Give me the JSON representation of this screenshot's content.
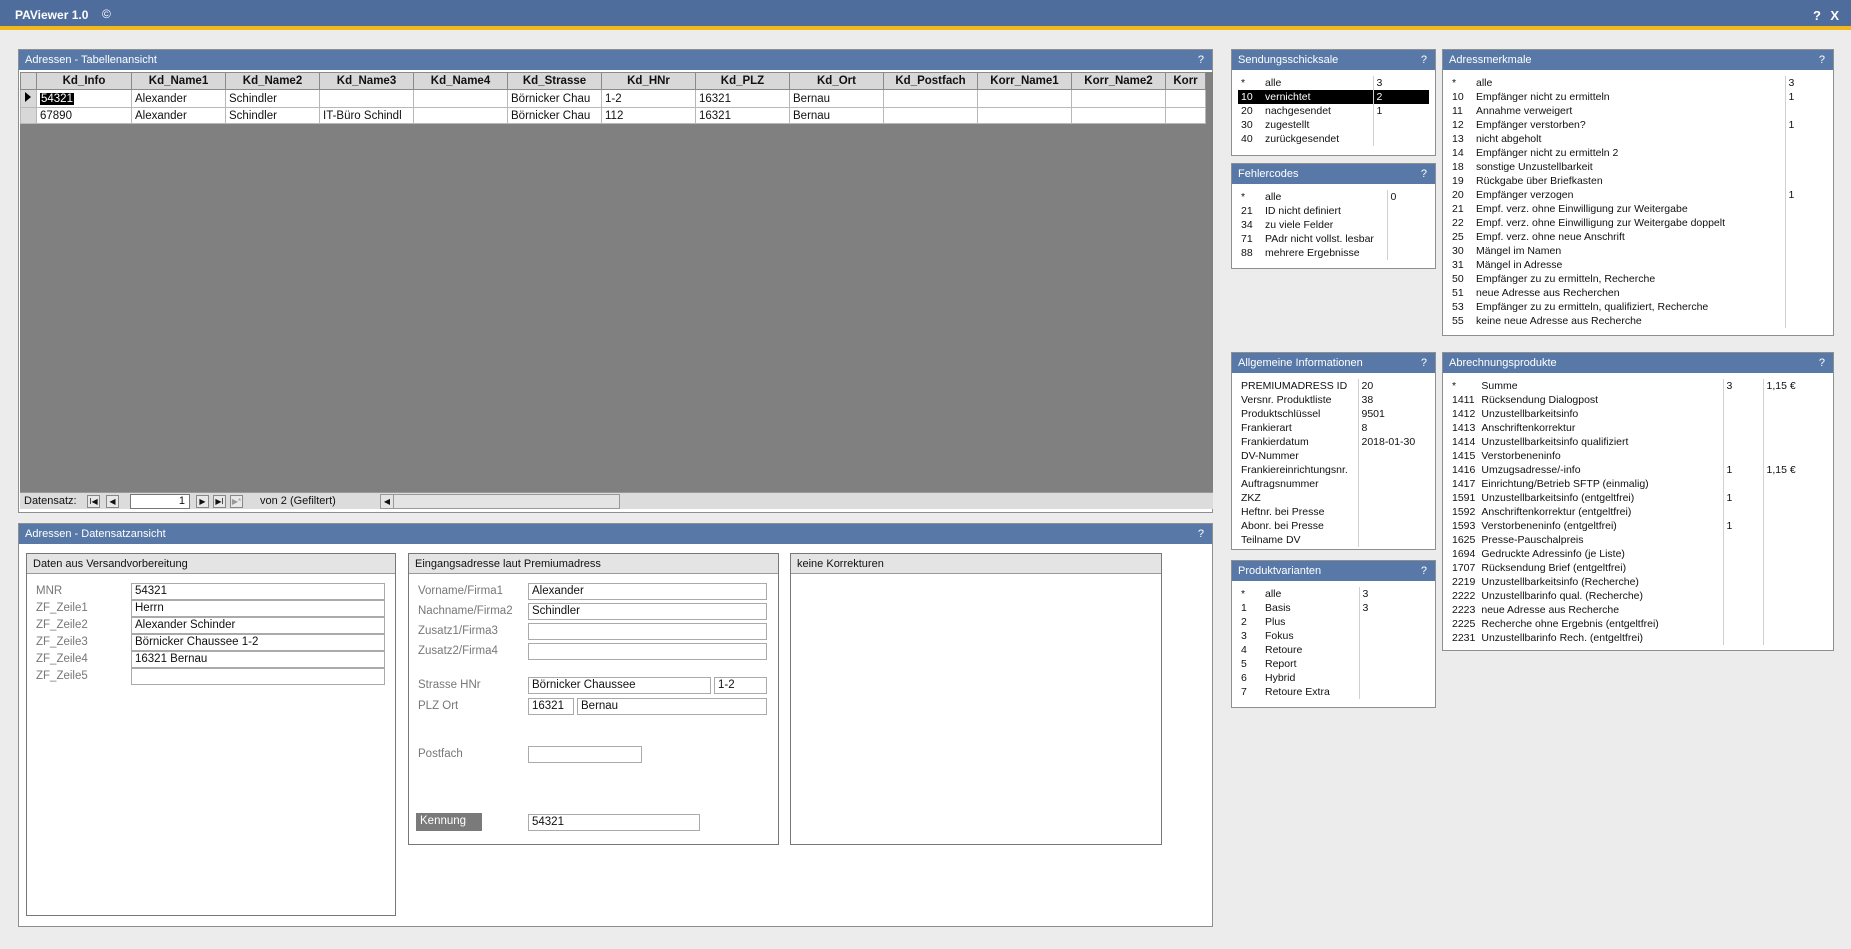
{
  "app": {
    "title": "PAViewer 1.0",
    "copyright": "©",
    "help": "?",
    "close": "X"
  },
  "table_view": {
    "title": "Adressen - Tabellenansicht",
    "help": "?",
    "columns": [
      "Kd_Info",
      "Kd_Name1",
      "Kd_Name2",
      "Kd_Name3",
      "Kd_Name4",
      "Kd_Strasse",
      "Kd_HNr",
      "Kd_PLZ",
      "Kd_Ort",
      "Kd_Postfach",
      "Korr_Name1",
      "Korr_Name2",
      "Korr"
    ],
    "rows": [
      [
        "54321",
        "Alexander",
        "Schindler",
        "",
        "",
        "Börnicker Chau",
        "1-2",
        "16321",
        "Bernau",
        "",
        "",
        "",
        ""
      ],
      [
        "67890",
        "Alexander",
        "Schindler",
        "IT-Büro Schindl",
        "",
        "Börnicker Chau",
        "112",
        "16321",
        "Bernau",
        "",
        "",
        "",
        ""
      ]
    ],
    "nav": {
      "label": "Datensatz:",
      "first": "I◀",
      "prev": "◀",
      "record": "1",
      "next": "▶",
      "last": "▶I",
      "new": "▶*",
      "of_text": "von  2 (Gefiltert)"
    }
  },
  "record_view": {
    "title": "Adressen - Datensatzansicht",
    "help": "?",
    "versand": {
      "title": "Daten aus Versandvorbereitung",
      "fields": [
        {
          "label": "MNR",
          "value": "54321"
        },
        {
          "label": "ZF_Zeile1",
          "value": "Herrn"
        },
        {
          "label": "ZF_Zeile2",
          "value": "Alexander Schinder"
        },
        {
          "label": "ZF_Zeile3",
          "value": "Börnicker Chaussee 1-2"
        },
        {
          "label": "ZF_Zeile4",
          "value": "16321 Bernau"
        },
        {
          "label": "ZF_Zeile5",
          "value": ""
        }
      ]
    },
    "eingang": {
      "title": "Eingangsadresse laut Premiumadress",
      "vorname_label": "Vorname/Firma1",
      "vorname": "Alexander",
      "nachname_label": "Nachname/Firma2",
      "nachname": "Schindler",
      "zusatz1_label": "Zusatz1/Firma3",
      "zusatz1": "",
      "zusatz2_label": "Zusatz2/Firma4",
      "zusatz2": "",
      "strasse_label": "Strasse HNr",
      "strasse": "Börnicker Chaussee",
      "hnr": "1-2",
      "plzort_label": "PLZ Ort",
      "plz": "16321",
      "ort": "Bernau",
      "postfach_label": "Postfach",
      "postfach": "",
      "kennung_label": "Kennung",
      "kennung": "54321"
    },
    "korrektur": {
      "title": "keine Korrekturen"
    }
  },
  "sendungsschicksale": {
    "title": "Sendungsschicksale",
    "help": "?",
    "rows": [
      [
        "*",
        "alle",
        "3"
      ],
      [
        "10",
        "vernichtet",
        "2"
      ],
      [
        "20",
        "nachgesendet",
        "1"
      ],
      [
        "30",
        "zugestellt",
        ""
      ],
      [
        "40",
        "zurückgesendet",
        ""
      ]
    ]
  },
  "fehlercodes": {
    "title": "Fehlercodes",
    "help": "?",
    "rows": [
      [
        "*",
        "alle",
        "0"
      ],
      [
        "21",
        "ID nicht definiert",
        ""
      ],
      [
        "34",
        "zu viele Felder",
        ""
      ],
      [
        "71",
        "PAdr nicht vollst. lesbar",
        ""
      ],
      [
        "88",
        "mehrere Ergebnisse",
        ""
      ]
    ]
  },
  "adressmerkmale": {
    "title": "Adressmerkmale",
    "help": "?",
    "rows": [
      [
        "*",
        "alle",
        "3"
      ],
      [
        "10",
        "Empfänger nicht zu ermitteln",
        "1"
      ],
      [
        "11",
        "Annahme verweigert",
        ""
      ],
      [
        "12",
        "Empfänger verstorben?",
        "1"
      ],
      [
        "13",
        "nicht abgeholt",
        ""
      ],
      [
        "14",
        "Empfänger nicht zu ermitteln 2",
        ""
      ],
      [
        "18",
        "sonstige Unzustellbarkeit",
        ""
      ],
      [
        "19",
        "Rückgabe über Briefkasten",
        ""
      ],
      [
        "20",
        "Empfänger verzogen",
        "1"
      ],
      [
        "21",
        "Empf. verz. ohne Einwilligung zur Weitergabe",
        ""
      ],
      [
        "22",
        "Empf. verz. ohne Einwilligung zur Weitergabe doppelt",
        ""
      ],
      [
        "25",
        "Empf. verz. ohne neue Anschrift",
        ""
      ],
      [
        "30",
        "Mängel im Namen",
        ""
      ],
      [
        "31",
        "Mängel in Adresse",
        ""
      ],
      [
        "50",
        "Empfänger zu zu ermitteln, Recherche",
        ""
      ],
      [
        "51",
        "neue Adresse aus Recherchen",
        ""
      ],
      [
        "53",
        "Empfänger zu zu ermitteln, qualifiziert, Recherche",
        ""
      ],
      [
        "55",
        "keine neue Adresse aus Recherche",
        ""
      ]
    ]
  },
  "allgemein": {
    "title": "Allgemeine Informationen",
    "help": "?",
    "rows": [
      [
        "PREMIUMADRESS ID",
        "20"
      ],
      [
        "Versnr. Produktliste",
        "38"
      ],
      [
        "Produktschlüssel",
        "9501"
      ],
      [
        "Frankierart",
        "8"
      ],
      [
        "Frankierdatum",
        "2018-01-30"
      ],
      [
        "DV-Nummer",
        ""
      ],
      [
        "Frankiereinrichtungsnr.",
        ""
      ],
      [
        "Auftragsnummer",
        ""
      ],
      [
        "ZKZ",
        ""
      ],
      [
        "Heftnr. bei Presse",
        ""
      ],
      [
        "Abonr. bei Presse",
        ""
      ],
      [
        "Teilname DV",
        ""
      ]
    ]
  },
  "produktvarianten": {
    "title": "Produktvarianten",
    "help": "?",
    "rows": [
      [
        "*",
        "alle",
        "3"
      ],
      [
        "1",
        "Basis",
        "3"
      ],
      [
        "2",
        "Plus",
        ""
      ],
      [
        "3",
        "Fokus",
        ""
      ],
      [
        "4",
        "Retoure",
        ""
      ],
      [
        "5",
        "Report",
        ""
      ],
      [
        "6",
        "Hybrid",
        ""
      ],
      [
        "7",
        "Retoure Extra",
        ""
      ]
    ]
  },
  "abrechnung": {
    "title": "Abrechnungsprodukte",
    "help": "?",
    "rows": [
      [
        "*",
        "Summe",
        "3",
        "1,15 €"
      ],
      [
        "1411",
        "Rücksendung Dialogpost",
        "",
        ""
      ],
      [
        "1412",
        "Unzustellbarkeitsinfo",
        "",
        ""
      ],
      [
        "1413",
        "Anschriftenkorrektur",
        "",
        ""
      ],
      [
        "1414",
        "Unzustellbarkeitsinfo qualifiziert",
        "",
        ""
      ],
      [
        "1415",
        "Verstorbeneninfo",
        "",
        ""
      ],
      [
        "1416",
        "Umzugsadresse/-info",
        "1",
        "1,15 €"
      ],
      [
        "1417",
        "Einrichtung/Betrieb SFTP (einmalig)",
        "",
        ""
      ],
      [
        "1591",
        "Unzustellbarkeitsinfo (entgeltfrei)",
        "1",
        ""
      ],
      [
        "1592",
        "Anschriftenkorrektur (entgeltfrei)",
        "",
        ""
      ],
      [
        "1593",
        "Verstorbeneninfo (entgeltfrei)",
        "1",
        ""
      ],
      [
        "1625",
        "Presse-Pauschalpreis",
        "",
        ""
      ],
      [
        "1694",
        "Gedruckte Adressinfo (je Liste)",
        "",
        ""
      ],
      [
        "1707",
        "Rücksendung Brief (entgeltfrei)",
        "",
        ""
      ],
      [
        "2219",
        "Unzustellbarkeitsinfo (Recherche)",
        "",
        ""
      ],
      [
        "2222",
        "Unzustellbarinfo qual. (Recherche)",
        "",
        ""
      ],
      [
        "2223",
        "neue Adresse aus Recherche",
        "",
        ""
      ],
      [
        "2225",
        "Recherche ohne Ergebnis (entgeltfrei)",
        "",
        ""
      ],
      [
        "2231",
        "Unzustellbarinfo Rech. (entgeltfrei)",
        "",
        ""
      ]
    ]
  },
  "colors": {
    "header": "#5879a8",
    "titlebar": "#4e6d9c",
    "accent": "#f2b81a"
  }
}
